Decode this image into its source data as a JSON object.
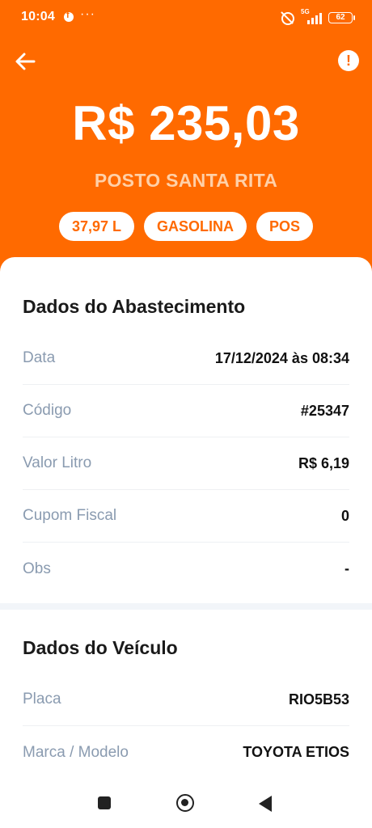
{
  "status_bar": {
    "time": "10:04",
    "more": "···",
    "network": "5G",
    "battery": "62"
  },
  "header": {
    "amount": "R$ 235,03",
    "station": "POSTO SANTA RITA",
    "tags": [
      "37,97 L",
      "GASOLINA",
      "POS"
    ]
  },
  "fueling": {
    "title": "Dados do Abastecimento",
    "rows": [
      {
        "label": "Data",
        "value": "17/12/2024 às 08:34"
      },
      {
        "label": "Código",
        "value": "#25347"
      },
      {
        "label": "Valor Litro",
        "value": "R$ 6,19"
      },
      {
        "label": "Cupom Fiscal",
        "value": "0"
      },
      {
        "label": "Obs",
        "value": "-"
      }
    ]
  },
  "vehicle": {
    "title": "Dados do Veículo",
    "rows": [
      {
        "label": "Placa",
        "value": "RIO5B53"
      },
      {
        "label": "Marca / Modelo",
        "value": "TOYOTA ETIOS"
      }
    ]
  },
  "colors": {
    "accent": "#ff6a00",
    "label": "#8a9bb0",
    "value": "#111111"
  },
  "icons": {
    "back": "arrow-left-icon",
    "alert": "exclamation-circle-icon"
  }
}
